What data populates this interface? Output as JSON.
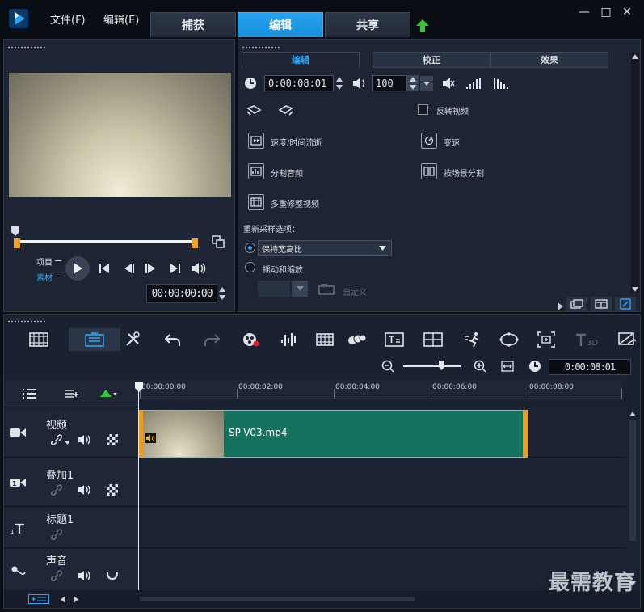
{
  "menu": {
    "file": "文件(F)",
    "edit": "编辑(E)"
  },
  "tabs": {
    "capture": "捕获",
    "edit": "编辑",
    "share": "共享"
  },
  "window": {
    "minimize": "—",
    "maximize": "□",
    "close": "✕"
  },
  "preview": {
    "project_label": "项目",
    "clip_label": "素材",
    "timecode": "00:00:00:00"
  },
  "options": {
    "subtabs": {
      "edit": "编辑",
      "correct": "校正",
      "effect": "效果"
    },
    "duration": "0:00:08:01",
    "volume": "100",
    "reverse_video": "反转视频",
    "speed_time_lapse": "速度/时间流逝",
    "variable_speed": "变速",
    "split_audio": "分割音频",
    "split_by_scene": "按场景分割",
    "multi_trim": "多重修整视频",
    "resample_title": "重新采样选项：",
    "keep_aspect": "保持宽高比",
    "pan_zoom": "摇动和缩放",
    "custom": "自定义"
  },
  "timeline": {
    "timecode": "0:00:08:01",
    "ruler": [
      "00:00:00:00",
      "00:00:02:00",
      "00:00:04:00",
      "00:00:06:00",
      "00:00:08:00"
    ],
    "tracks": {
      "video": "视频",
      "overlay": "叠加1",
      "title": "标题1",
      "voice": "声音"
    },
    "clip": {
      "name": "SP-V03.mp4"
    }
  },
  "watermark": "最需教育",
  "colors": {
    "accent": "#1a8fda",
    "clip": "#14725f",
    "clip_edge": "#f39a18"
  }
}
